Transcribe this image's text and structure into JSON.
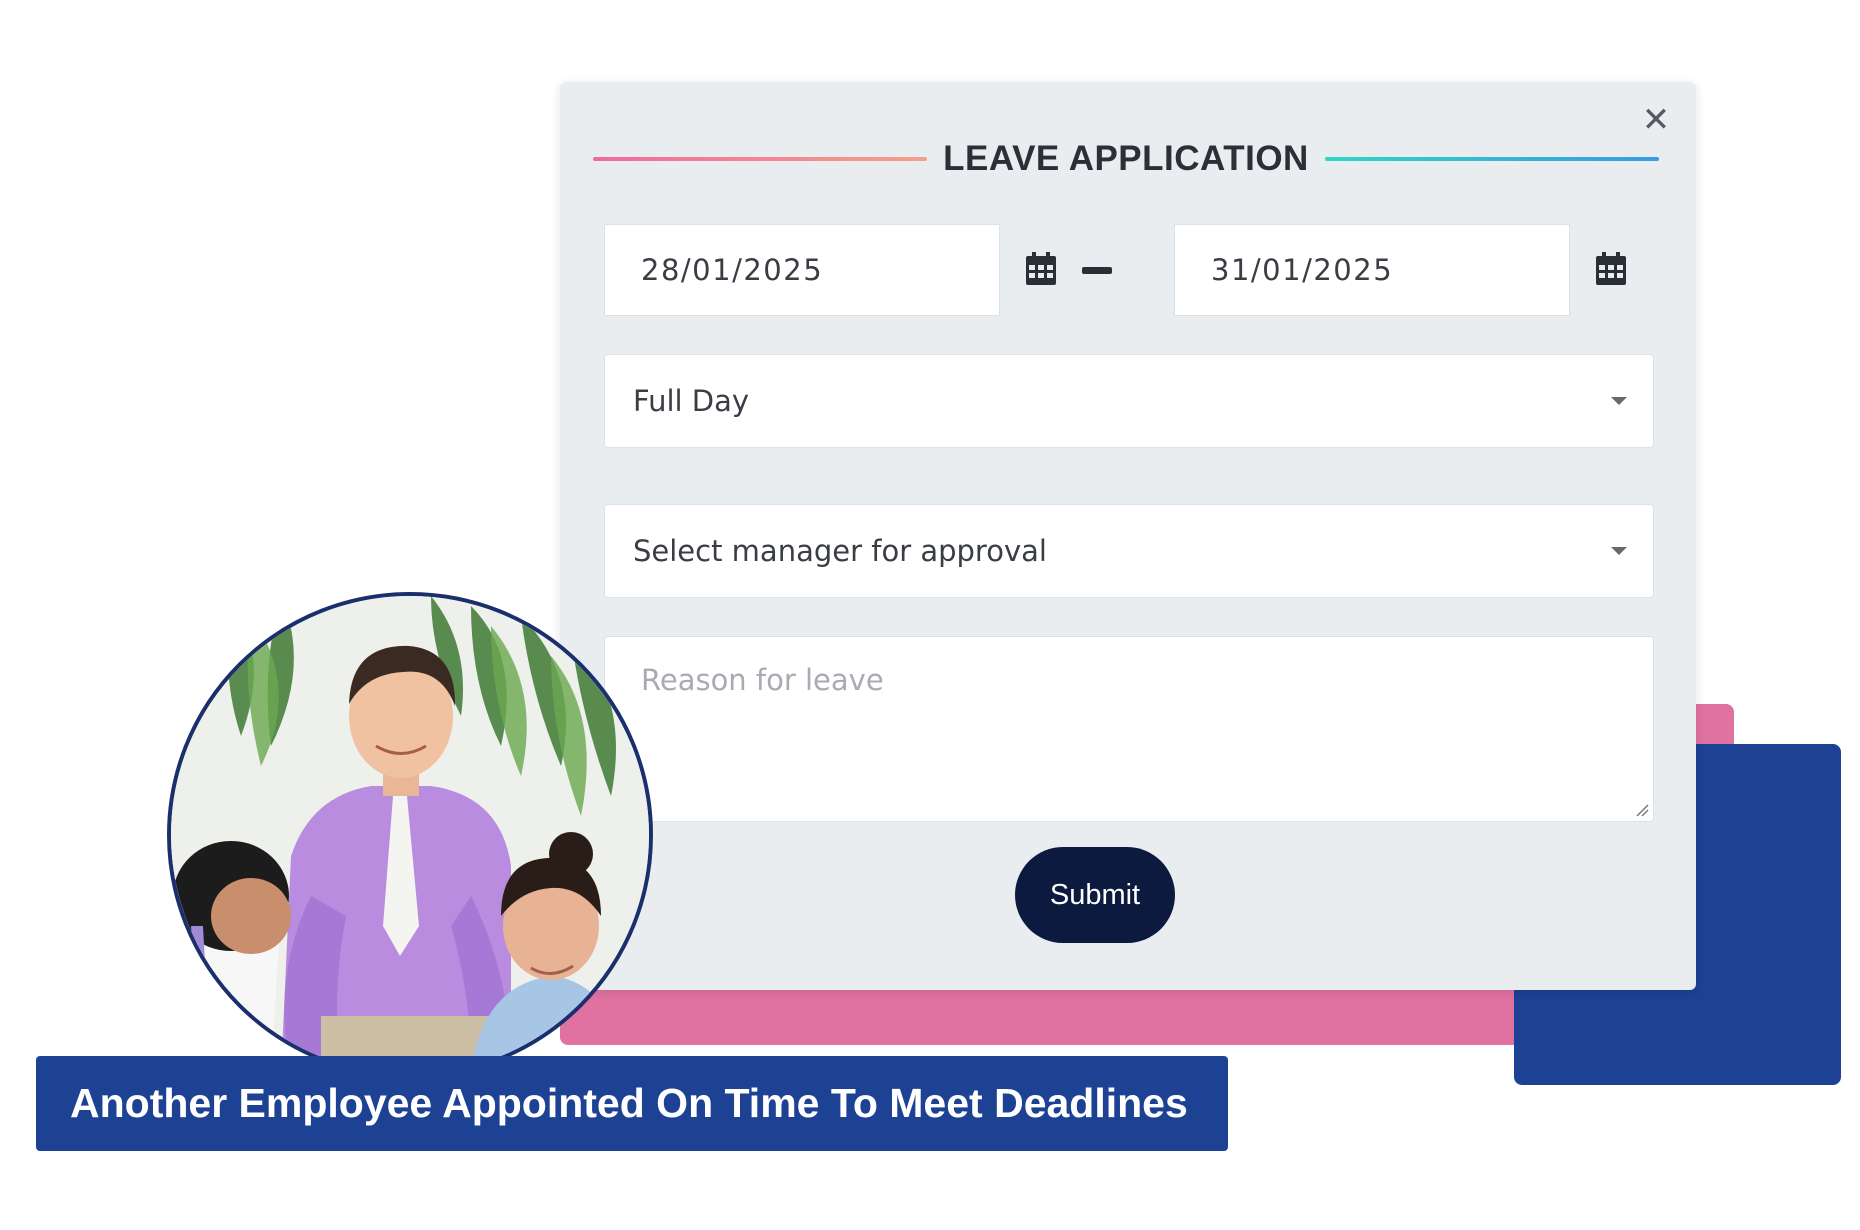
{
  "modal": {
    "title": "LEAVE APPLICATION",
    "close_icon": "close-icon",
    "close_symbol": "✕",
    "date_from": "28/01/2025",
    "date_to": "31/01/2025",
    "calendar_icon": "calendar-icon",
    "leave_type": {
      "selected": "Full Day"
    },
    "manager": {
      "selected": "Select manager for approval"
    },
    "reason": {
      "placeholder": "Reason for leave",
      "value": ""
    },
    "submit_label": "Submit"
  },
  "caption": {
    "text": "Another Employee Appointed On Time To Meet Deadlines"
  },
  "colors": {
    "modal_bg": "#eaedf0",
    "pink_accent": "#e072a1",
    "blue_accent": "#1d4294",
    "submit_bg": "#0b1a3e",
    "rule_left": [
      "#f06b9c",
      "#f5a08a"
    ],
    "rule_right": [
      "#2fd6c3",
      "#3a9be0"
    ]
  }
}
